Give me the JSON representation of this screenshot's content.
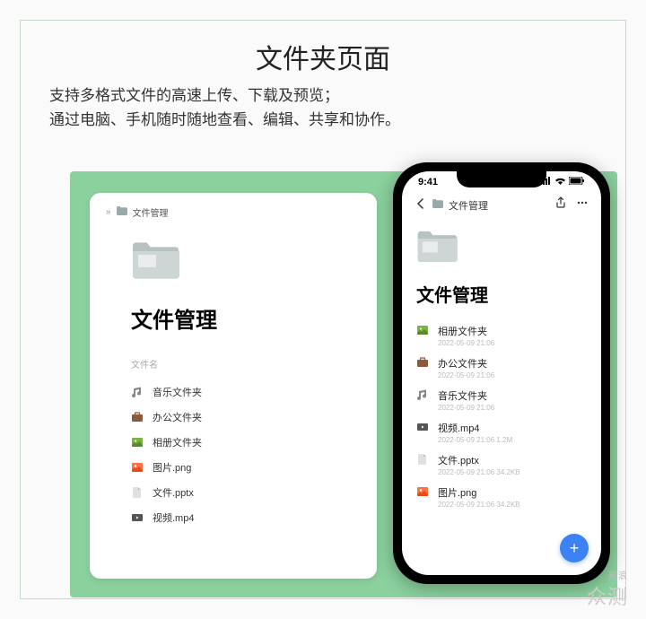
{
  "title": "文件夹页面",
  "subtitle_line1": "支持多格式文件的高速上传、下载及预览；",
  "subtitle_line2": "通过电脑、手机随时随地查看、编辑、共享和协作。",
  "watermark": "众测",
  "watermark_small": "新浪",
  "desktop": {
    "breadcrumb_sep": "»",
    "breadcrumb": "文件管理",
    "heading": "文件管理",
    "col_name": "文件名",
    "rows": [
      {
        "icon": "music",
        "label": "音乐文件夹"
      },
      {
        "icon": "briefcase",
        "label": "办公文件夹"
      },
      {
        "icon": "gallery",
        "label": "相册文件夹"
      },
      {
        "icon": "image",
        "label": "图片.png"
      },
      {
        "icon": "file",
        "label": "文件.pptx"
      },
      {
        "icon": "video",
        "label": "视频.mp4"
      }
    ]
  },
  "phone": {
    "time": "9:41",
    "breadcrumb": "文件管理",
    "heading": "文件管理",
    "rows": [
      {
        "icon": "gallery",
        "name": "相册文件夹",
        "meta": "2022-05-09 21:06"
      },
      {
        "icon": "briefcase",
        "name": "办公文件夹",
        "meta": "2022-05-09 21:06"
      },
      {
        "icon": "music",
        "name": "音乐文件夹",
        "meta": "2022-05-09 21:06"
      },
      {
        "icon": "video",
        "name": "视频.mp4",
        "meta": "2022-05-09 21:06   1.2M"
      },
      {
        "icon": "file",
        "name": "文件.pptx",
        "meta": "2022-05-09 21:06   34.2KB"
      },
      {
        "icon": "image",
        "name": "图片.png",
        "meta": "2022-05-09 21:06   34.2KB"
      }
    ]
  }
}
